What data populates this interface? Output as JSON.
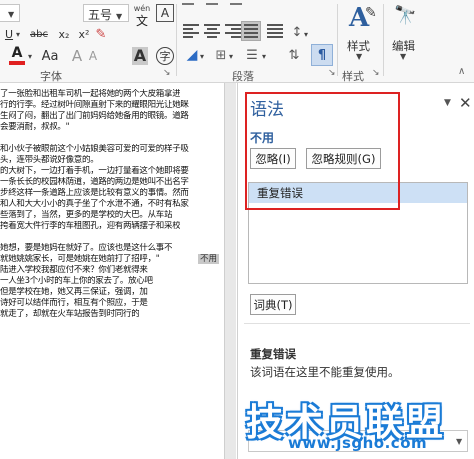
{
  "ribbon": {
    "font_size_value": "五号",
    "font_group_label": "字体",
    "paragraph_group_label": "段落",
    "styles_group_label": "样式",
    "styles_label": "样式",
    "edit_label": "编辑",
    "wen_label": "wén"
  },
  "document": {
    "lines": [
      "了一张脸和出租车司机一起将她的两个大皮箱拿进",
      "行的行李。经过树叶间隙直射下来的耀眼阳光让她眯",
      "生闷了闷，翻出了出门前妈妈给她备用的眼镜。道路",
      "会要消耐，叔叔。\"",
      "",
      "和小伙子被眼前这个小姑娘美容可爱的可爱的样子吸",
      "头，连带头都说好像意的。",
      "的大树下，一边打着手机，一边打量着这个她即将要",
      "一条长长的校园林荫道，道路的两边是她叫不出名字",
      "步终这样一条道路上应该是比较有意义的事情。然而",
      "和人和大大小小的真子坐了个水泄不通，不时有私家",
      "些落到了，当然，更多的是学校的大巴。从车站",
      "挎着宽大件行李的车租图孔，迎有两辆摆子和采校",
      "",
      "她想，要是她妈在就好了。应该也是这什么事不",
      "就她姚姚家长，可是她姚在她前打了招呼，\"",
      "陆进入学校我都应付不来？你们老就得来",
      "一人坐3个小时的车上你的家去了。放心吧",
      "但是学校在她，她又再三保证，强调，加",
      "诗好可以结伴而行，相互有个照应，于是",
      "就走了，却就在火车站报告到时同行的"
    ],
    "highlighted_tail": "不用"
  },
  "pane": {
    "title": "语法",
    "issue_word": "不用",
    "ignore_label": "忽略(I)",
    "ignore_rule_label": "忽略规则(G)",
    "suggestion": "重复错误",
    "dictionary_label": "词典(T)",
    "explain_title": "重复错误",
    "explain_text": "该词语在这里不能重复使用。"
  },
  "watermark": {
    "text": "技术员联盟",
    "url": "www.jsgho.com"
  }
}
